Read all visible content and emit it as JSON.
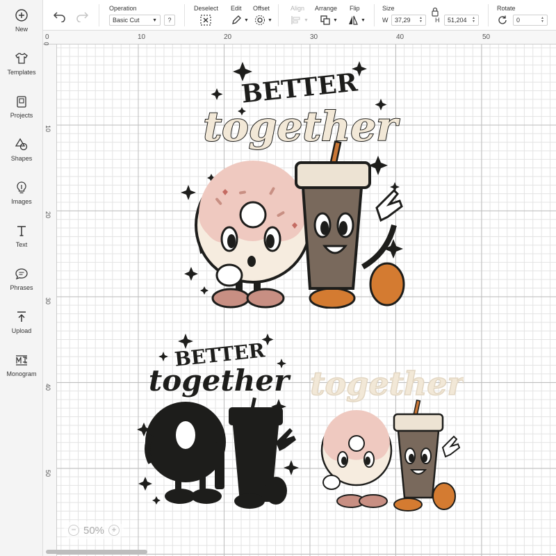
{
  "sidebar": {
    "items": [
      {
        "label": "New",
        "icon": "plus-circle-icon"
      },
      {
        "label": "Templates",
        "icon": "tshirt-icon"
      },
      {
        "label": "Projects",
        "icon": "projects-icon"
      },
      {
        "label": "Shapes",
        "icon": "shapes-icon"
      },
      {
        "label": "Images",
        "icon": "lightbulb-icon"
      },
      {
        "label": "Text",
        "icon": "text-icon"
      },
      {
        "label": "Phrases",
        "icon": "speech-bubble-icon"
      },
      {
        "label": "Upload",
        "icon": "upload-icon"
      },
      {
        "label": "Monogram",
        "icon": "monogram-icon"
      }
    ]
  },
  "toolbar": {
    "operation": {
      "title": "Operation",
      "value": "Basic Cut",
      "help": "?"
    },
    "deselect": {
      "title": "Deselect"
    },
    "edit": {
      "title": "Edit"
    },
    "offset": {
      "title": "Offset"
    },
    "align": {
      "title": "Align"
    },
    "arrange": {
      "title": "Arrange"
    },
    "flip": {
      "title": "Flip"
    },
    "size": {
      "title": "Size",
      "w_label": "W",
      "w_value": "37,29",
      "h_label": "H",
      "h_value": "51,204"
    },
    "rotate": {
      "title": "Rotate",
      "value": "0"
    }
  },
  "ruler": {
    "top": [
      "0",
      "10",
      "20",
      "30",
      "40",
      "50"
    ],
    "left": [
      "0",
      "10",
      "20",
      "30",
      "40",
      "50"
    ]
  },
  "design": {
    "main_top": "BETTER",
    "main_bottom": "together",
    "black_top": "BETTER",
    "black_bottom": "together",
    "small_text": "together"
  },
  "zoom": {
    "minus": "−",
    "level": "50%",
    "plus": "+"
  },
  "colors": {
    "donut": "#f6ecdf",
    "frosting": "#efc9c0",
    "cup": "#79695c",
    "lid": "#ede3d3",
    "straw": "#c97737",
    "shoe_orange": "#d47b31",
    "shoe_pink": "#c88f83",
    "ink": "#1d1d1b",
    "cream_text": "#f2e8d7"
  }
}
